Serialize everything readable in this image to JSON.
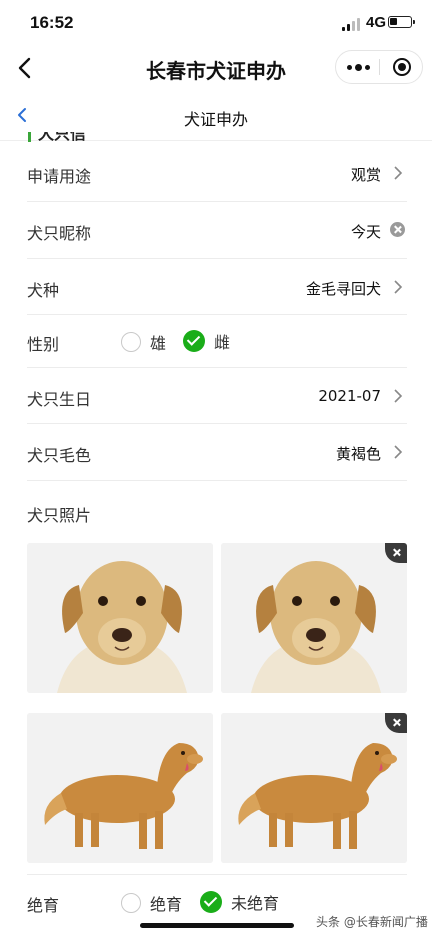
{
  "status_bar": {
    "time": "16:52",
    "network": "4G"
  },
  "nav": {
    "title": "长春市犬证申办"
  },
  "subheader": {
    "title": "犬证申办"
  },
  "section": {
    "heading": "犬只信息"
  },
  "fields": {
    "purpose": {
      "label": "申请用途",
      "value": "观赏"
    },
    "nickname": {
      "label": "犬只昵称",
      "value": "今天"
    },
    "breed": {
      "label": "犬种",
      "value": "金毛寻回犬"
    },
    "gender": {
      "label": "性别",
      "options": [
        "雄",
        "雌"
      ],
      "selected": "雌"
    },
    "birthday": {
      "label": "犬只生日",
      "value": "2021-07"
    },
    "color": {
      "label": "犬只毛色",
      "value": "黄褐色"
    },
    "photos": {
      "label": "犬只照片"
    },
    "sterilization": {
      "label": "绝育",
      "options": [
        "绝育",
        "未绝育"
      ],
      "selected": "未绝育"
    }
  },
  "watermark": "头条 @长春新闻广播",
  "colors": {
    "accent_green": "#1aad19",
    "section_bar": "#3aa63a"
  }
}
